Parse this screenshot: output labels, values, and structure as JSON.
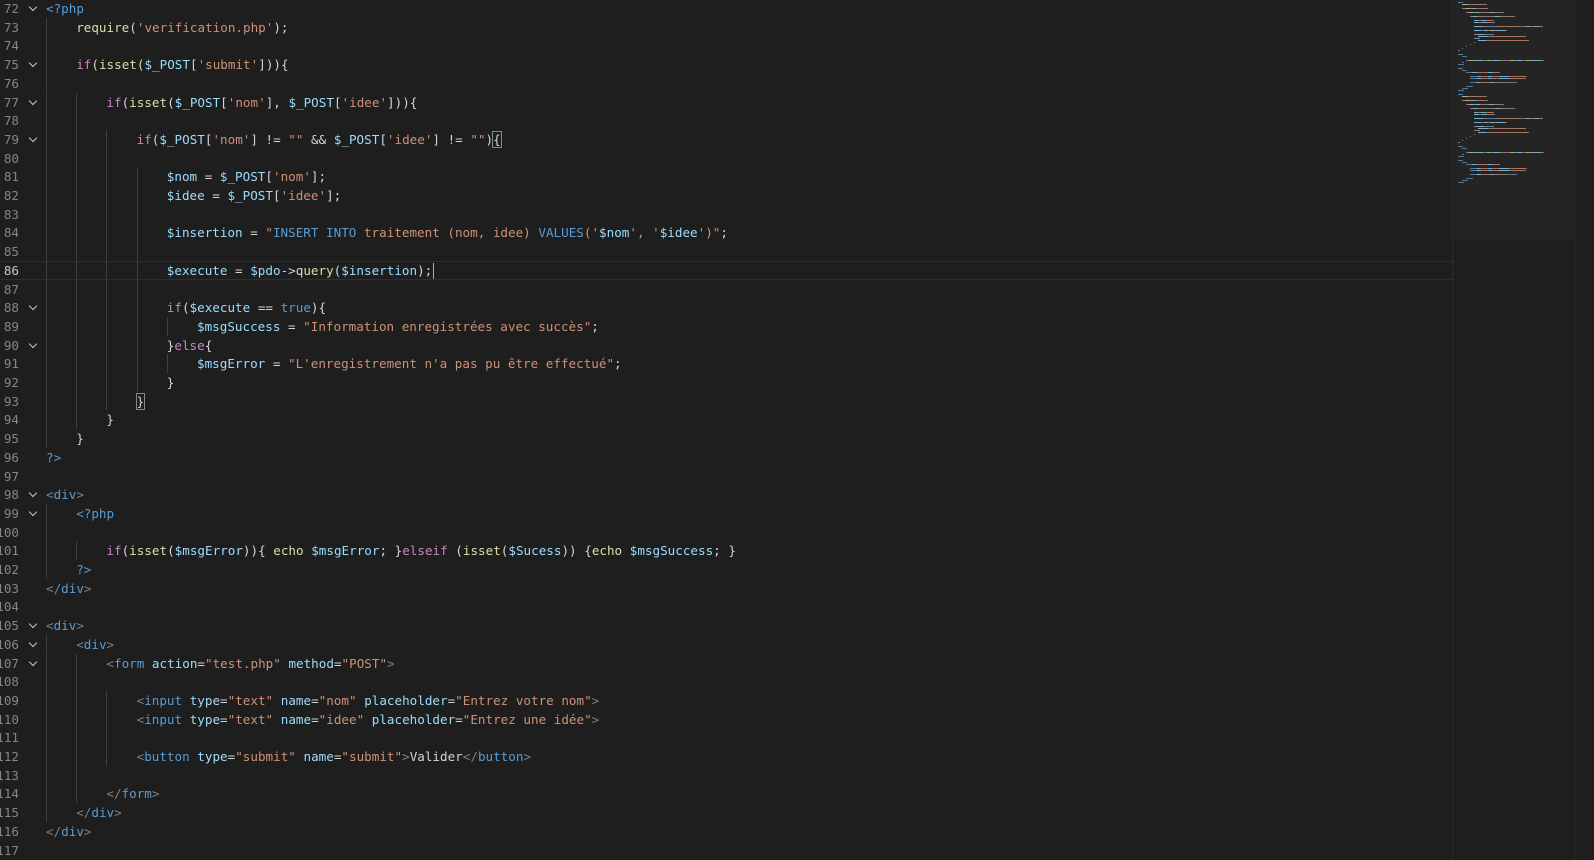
{
  "editor": {
    "theme_colors": {
      "background": "#1e1e1e",
      "line_number": "#858585",
      "string": "#ce9178",
      "variable": "#9cdcfe",
      "keyword": "#c586c0",
      "function": "#dcdcaa",
      "tag": "#569cd6"
    },
    "current_line": 86,
    "lines": [
      {
        "n": "72",
        "fold": true,
        "indent": 0,
        "tokens": [
          [
            "php-tag",
            "<?php"
          ]
        ]
      },
      {
        "n": "73",
        "fold": false,
        "indent": 1,
        "tokens": [
          [
            "fn",
            "require"
          ],
          [
            "plain",
            "("
          ],
          [
            "str",
            "'verification.php'"
          ],
          [
            "plain",
            ");"
          ]
        ]
      },
      {
        "n": "74",
        "fold": false,
        "indent": 0,
        "tokens": []
      },
      {
        "n": "75",
        "fold": true,
        "indent": 1,
        "tokens": [
          [
            "kw",
            "if"
          ],
          [
            "plain",
            "("
          ],
          [
            "fn",
            "isset"
          ],
          [
            "plain",
            "("
          ],
          [
            "var",
            "$_POST"
          ],
          [
            "plain",
            "["
          ],
          [
            "str",
            "'submit'"
          ],
          [
            "plain",
            "])){"
          ]
        ]
      },
      {
        "n": "76",
        "fold": false,
        "indent": 0,
        "tokens": []
      },
      {
        "n": "77",
        "fold": true,
        "indent": 2,
        "tokens": [
          [
            "kw",
            "if"
          ],
          [
            "plain",
            "("
          ],
          [
            "fn",
            "isset"
          ],
          [
            "plain",
            "("
          ],
          [
            "var",
            "$_POST"
          ],
          [
            "plain",
            "["
          ],
          [
            "str",
            "'nom'"
          ],
          [
            "plain",
            "], "
          ],
          [
            "var",
            "$_POST"
          ],
          [
            "plain",
            "["
          ],
          [
            "str",
            "'idee'"
          ],
          [
            "plain",
            "])){"
          ]
        ]
      },
      {
        "n": "78",
        "fold": false,
        "indent": 0,
        "tokens": []
      },
      {
        "n": "79",
        "fold": true,
        "indent": 3,
        "tokens": [
          [
            "kw",
            "if"
          ],
          [
            "plain",
            "("
          ],
          [
            "var",
            "$_POST"
          ],
          [
            "plain",
            "["
          ],
          [
            "str",
            "'nom'"
          ],
          [
            "plain",
            "] != "
          ],
          [
            "str",
            "\"\""
          ],
          [
            "plain",
            " && "
          ],
          [
            "var",
            "$_POST"
          ],
          [
            "plain",
            "["
          ],
          [
            "str",
            "'idee'"
          ],
          [
            "plain",
            "] != "
          ],
          [
            "str",
            "\"\""
          ],
          [
            "plain",
            ")"
          ],
          [
            "bracket",
            "{"
          ]
        ]
      },
      {
        "n": "80",
        "fold": false,
        "indent": 0,
        "tokens": []
      },
      {
        "n": "81",
        "fold": false,
        "indent": 4,
        "tokens": [
          [
            "var",
            "$nom"
          ],
          [
            "plain",
            " = "
          ],
          [
            "var",
            "$_POST"
          ],
          [
            "plain",
            "["
          ],
          [
            "str",
            "'nom'"
          ],
          [
            "plain",
            "];"
          ]
        ]
      },
      {
        "n": "82",
        "fold": false,
        "indent": 4,
        "tokens": [
          [
            "var",
            "$idee"
          ],
          [
            "plain",
            " = "
          ],
          [
            "var",
            "$_POST"
          ],
          [
            "plain",
            "["
          ],
          [
            "str",
            "'idee'"
          ],
          [
            "plain",
            "];"
          ]
        ]
      },
      {
        "n": "83",
        "fold": false,
        "indent": 0,
        "tokens": []
      },
      {
        "n": "84",
        "fold": false,
        "indent": 4,
        "tokens": [
          [
            "var",
            "$insertion"
          ],
          [
            "plain",
            " = "
          ],
          [
            "str",
            "\""
          ],
          [
            "sqlkw",
            "INSERT INTO"
          ],
          [
            "str",
            " traitement (nom, idee) "
          ],
          [
            "sqlkw",
            "VALUES"
          ],
          [
            "str",
            "('"
          ],
          [
            "var",
            "$nom"
          ],
          [
            "str",
            "', '"
          ],
          [
            "var",
            "$idee"
          ],
          [
            "str",
            "')\""
          ],
          [
            "plain",
            ";"
          ]
        ]
      },
      {
        "n": "85",
        "fold": false,
        "indent": 0,
        "tokens": []
      },
      {
        "n": "86",
        "fold": false,
        "indent": 4,
        "tokens": [
          [
            "var",
            "$execute"
          ],
          [
            "plain",
            " = "
          ],
          [
            "var",
            "$pdo"
          ],
          [
            "plain",
            "->"
          ],
          [
            "fn",
            "query"
          ],
          [
            "plain",
            "("
          ],
          [
            "var",
            "$insertion"
          ],
          [
            "plain",
            ");"
          ],
          [
            "cursor",
            ""
          ]
        ]
      },
      {
        "n": "87",
        "fold": false,
        "indent": 0,
        "tokens": []
      },
      {
        "n": "88",
        "fold": true,
        "indent": 4,
        "tokens": [
          [
            "kw",
            "if"
          ],
          [
            "plain",
            "("
          ],
          [
            "var",
            "$execute"
          ],
          [
            "plain",
            " == "
          ],
          [
            "bool",
            "true"
          ],
          [
            "plain",
            "){"
          ]
        ]
      },
      {
        "n": "89",
        "fold": false,
        "indent": 5,
        "tokens": [
          [
            "var",
            "$msgSuccess"
          ],
          [
            "plain",
            " = "
          ],
          [
            "str",
            "\"Information enregistrées avec succès\""
          ],
          [
            "plain",
            ";"
          ]
        ]
      },
      {
        "n": "90",
        "fold": true,
        "indent": 4,
        "tokens": [
          [
            "plain",
            "}"
          ],
          [
            "kw",
            "else"
          ],
          [
            "plain",
            "{"
          ]
        ]
      },
      {
        "n": "91",
        "fold": false,
        "indent": 5,
        "tokens": [
          [
            "var",
            "$msgError"
          ],
          [
            "plain",
            " = "
          ],
          [
            "str",
            "\"L'enregistrement n'a pas pu être effectué\""
          ],
          [
            "plain",
            ";"
          ]
        ]
      },
      {
        "n": "92",
        "fold": false,
        "indent": 4,
        "tokens": [
          [
            "plain",
            "}"
          ]
        ]
      },
      {
        "n": "93",
        "fold": false,
        "indent": 3,
        "tokens": [
          [
            "bracket",
            "}"
          ]
        ]
      },
      {
        "n": "94",
        "fold": false,
        "indent": 2,
        "tokens": [
          [
            "plain",
            "}"
          ]
        ]
      },
      {
        "n": "95",
        "fold": false,
        "indent": 1,
        "tokens": [
          [
            "plain",
            "}"
          ]
        ]
      },
      {
        "n": "96",
        "fold": false,
        "indent": 0,
        "tokens": [
          [
            "php-tag",
            "?>"
          ]
        ]
      },
      {
        "n": "97",
        "fold": false,
        "indent": 0,
        "tokens": []
      },
      {
        "n": "98",
        "fold": true,
        "indent": 0,
        "tokens": [
          [
            "tag-bracket",
            "<"
          ],
          [
            "tag",
            "div"
          ],
          [
            "tag-bracket",
            ">"
          ]
        ]
      },
      {
        "n": "99",
        "fold": true,
        "indent": 1,
        "tokens": [
          [
            "php-tag",
            "<?php"
          ]
        ]
      },
      {
        "n": "100",
        "fold": false,
        "indent": 0,
        "tokens": []
      },
      {
        "n": "101",
        "fold": false,
        "indent": 2,
        "tokens": [
          [
            "kw",
            "if"
          ],
          [
            "plain",
            "("
          ],
          [
            "fn",
            "isset"
          ],
          [
            "plain",
            "("
          ],
          [
            "var",
            "$msgError"
          ],
          [
            "plain",
            ")){ "
          ],
          [
            "fn",
            "echo"
          ],
          [
            "plain",
            " "
          ],
          [
            "var",
            "$msgError"
          ],
          [
            "plain",
            "; }"
          ],
          [
            "kw",
            "elseif"
          ],
          [
            "plain",
            " ("
          ],
          [
            "fn",
            "isset"
          ],
          [
            "plain",
            "("
          ],
          [
            "var",
            "$Sucess"
          ],
          [
            "plain",
            ")) {"
          ],
          [
            "fn",
            "echo"
          ],
          [
            "plain",
            " "
          ],
          [
            "var",
            "$msgSuccess"
          ],
          [
            "plain",
            "; }"
          ]
        ]
      },
      {
        "n": "102",
        "fold": false,
        "indent": 1,
        "tokens": [
          [
            "php-tag",
            "?>"
          ]
        ]
      },
      {
        "n": "103",
        "fold": false,
        "indent": 0,
        "tokens": [
          [
            "tag-bracket",
            "</"
          ],
          [
            "tag",
            "div"
          ],
          [
            "tag-bracket",
            ">"
          ]
        ]
      },
      {
        "n": "104",
        "fold": false,
        "indent": 0,
        "tokens": []
      },
      {
        "n": "105",
        "fold": true,
        "indent": 0,
        "tokens": [
          [
            "tag-bracket",
            "<"
          ],
          [
            "tag",
            "div"
          ],
          [
            "tag-bracket",
            ">"
          ]
        ]
      },
      {
        "n": "106",
        "fold": true,
        "indent": 1,
        "tokens": [
          [
            "tag-bracket",
            "<"
          ],
          [
            "tag",
            "div"
          ],
          [
            "tag-bracket",
            ">"
          ]
        ]
      },
      {
        "n": "107",
        "fold": true,
        "indent": 2,
        "tokens": [
          [
            "tag-bracket",
            "<"
          ],
          [
            "tag",
            "form"
          ],
          [
            "plain",
            " "
          ],
          [
            "attr",
            "action"
          ],
          [
            "plain",
            "="
          ],
          [
            "str",
            "\"test.php\""
          ],
          [
            "plain",
            " "
          ],
          [
            "attr",
            "method"
          ],
          [
            "plain",
            "="
          ],
          [
            "str",
            "\"POST\""
          ],
          [
            "tag-bracket",
            ">"
          ]
        ]
      },
      {
        "n": "108",
        "fold": false,
        "indent": 0,
        "tokens": []
      },
      {
        "n": "109",
        "fold": false,
        "indent": 3,
        "tokens": [
          [
            "tag-bracket",
            "<"
          ],
          [
            "tag",
            "input"
          ],
          [
            "plain",
            " "
          ],
          [
            "attr",
            "type"
          ],
          [
            "plain",
            "="
          ],
          [
            "str",
            "\"text\""
          ],
          [
            "plain",
            " "
          ],
          [
            "attr",
            "name"
          ],
          [
            "plain",
            "="
          ],
          [
            "str",
            "\"nom\""
          ],
          [
            "plain",
            " "
          ],
          [
            "attr",
            "placeholder"
          ],
          [
            "plain",
            "="
          ],
          [
            "str",
            "\"Entrez votre nom\""
          ],
          [
            "tag-bracket",
            ">"
          ]
        ]
      },
      {
        "n": "110",
        "fold": false,
        "indent": 3,
        "tokens": [
          [
            "tag-bracket",
            "<"
          ],
          [
            "tag",
            "input"
          ],
          [
            "plain",
            " "
          ],
          [
            "attr",
            "type"
          ],
          [
            "plain",
            "="
          ],
          [
            "str",
            "\"text\""
          ],
          [
            "plain",
            " "
          ],
          [
            "attr",
            "name"
          ],
          [
            "plain",
            "="
          ],
          [
            "str",
            "\"idee\""
          ],
          [
            "plain",
            " "
          ],
          [
            "attr",
            "placeholder"
          ],
          [
            "plain",
            "="
          ],
          [
            "str",
            "\"Entrez une idée\""
          ],
          [
            "tag-bracket",
            ">"
          ]
        ]
      },
      {
        "n": "111",
        "fold": false,
        "indent": 0,
        "tokens": []
      },
      {
        "n": "112",
        "fold": false,
        "indent": 3,
        "tokens": [
          [
            "tag-bracket",
            "<"
          ],
          [
            "tag",
            "button"
          ],
          [
            "plain",
            " "
          ],
          [
            "attr",
            "type"
          ],
          [
            "plain",
            "="
          ],
          [
            "str",
            "\"submit\""
          ],
          [
            "plain",
            " "
          ],
          [
            "attr",
            "name"
          ],
          [
            "plain",
            "="
          ],
          [
            "str",
            "\"submit\""
          ],
          [
            "tag-bracket",
            ">"
          ],
          [
            "plain",
            "Valider"
          ],
          [
            "tag-bracket",
            "</"
          ],
          [
            "tag",
            "button"
          ],
          [
            "tag-bracket",
            ">"
          ]
        ]
      },
      {
        "n": "113",
        "fold": false,
        "indent": 0,
        "tokens": []
      },
      {
        "n": "114",
        "fold": false,
        "indent": 2,
        "tokens": [
          [
            "tag-bracket",
            "</"
          ],
          [
            "tag",
            "form"
          ],
          [
            "tag-bracket",
            ">"
          ]
        ]
      },
      {
        "n": "115",
        "fold": false,
        "indent": 1,
        "tokens": [
          [
            "tag-bracket",
            "</"
          ],
          [
            "tag",
            "div"
          ],
          [
            "tag-bracket",
            ">"
          ]
        ]
      },
      {
        "n": "116",
        "fold": false,
        "indent": 0,
        "tokens": [
          [
            "tag-bracket",
            "</"
          ],
          [
            "tag",
            "div"
          ],
          [
            "tag-bracket",
            ">"
          ]
        ]
      },
      {
        "n": "117",
        "fold": false,
        "indent": 0,
        "tokens": []
      }
    ]
  }
}
